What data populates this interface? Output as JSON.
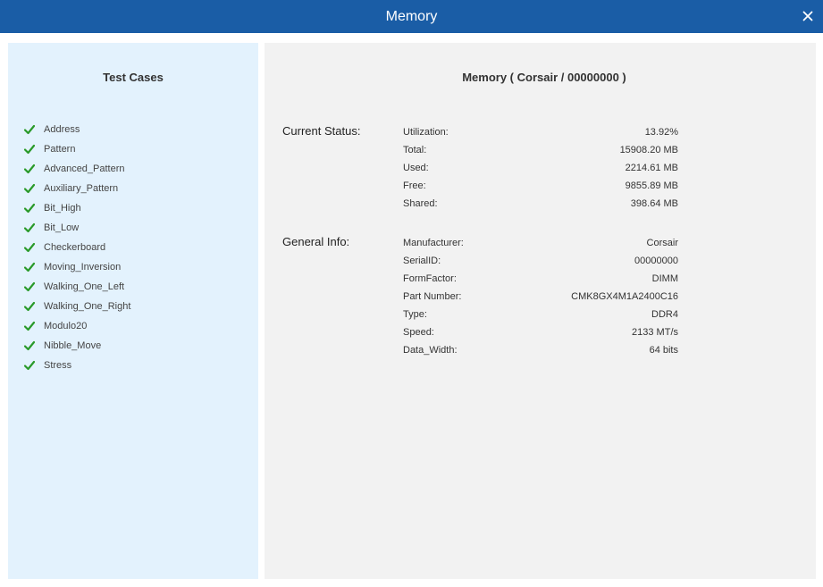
{
  "window": {
    "title": "Memory",
    "close_symbol": "×"
  },
  "test_cases": {
    "title": "Test Cases",
    "items": [
      {
        "label": "Address",
        "status": "passed"
      },
      {
        "label": "Pattern",
        "status": "passed"
      },
      {
        "label": "Advanced_Pattern",
        "status": "passed"
      },
      {
        "label": "Auxiliary_Pattern",
        "status": "passed"
      },
      {
        "label": "Bit_High",
        "status": "passed"
      },
      {
        "label": "Bit_Low",
        "status": "passed"
      },
      {
        "label": "Checkerboard",
        "status": "passed"
      },
      {
        "label": "Moving_Inversion",
        "status": "passed"
      },
      {
        "label": "Walking_One_Left",
        "status": "passed"
      },
      {
        "label": "Walking_One_Right",
        "status": "passed"
      },
      {
        "label": "Modulo20",
        "status": "passed"
      },
      {
        "label": "Nibble_Move",
        "status": "passed"
      },
      {
        "label": "Stress",
        "status": "passed"
      }
    ]
  },
  "device": {
    "title": "Memory ( Corsair / 00000000 )",
    "current_status": {
      "label": "Current Status:",
      "rows": [
        {
          "key": "Utilization:",
          "value": "13.92%"
        },
        {
          "key": "Total:",
          "value": "15908.20 MB"
        },
        {
          "key": "Used:",
          "value": "2214.61 MB"
        },
        {
          "key": "Free:",
          "value": "9855.89 MB"
        },
        {
          "key": "Shared:",
          "value": "398.64 MB"
        }
      ]
    },
    "general_info": {
      "label": "General Info:",
      "rows": [
        {
          "key": "Manufacturer:",
          "value": "Corsair"
        },
        {
          "key": "SerialID:",
          "value": "00000000"
        },
        {
          "key": "FormFactor:",
          "value": "DIMM"
        },
        {
          "key": "Part Number:",
          "value": "CMK8GX4M1A2400C16"
        },
        {
          "key": "Type:",
          "value": "DDR4"
        },
        {
          "key": "Speed:",
          "value": "2133 MT/s"
        },
        {
          "key": "Data_Width:",
          "value": "64 bits"
        }
      ]
    }
  },
  "colors": {
    "titlebar": "#1a5da6",
    "left_panel": "#e3f2fd",
    "right_panel": "#f2f2f2",
    "check": "#2a9a2a"
  },
  "icons": {
    "check": "check-icon",
    "close": "close-icon"
  }
}
